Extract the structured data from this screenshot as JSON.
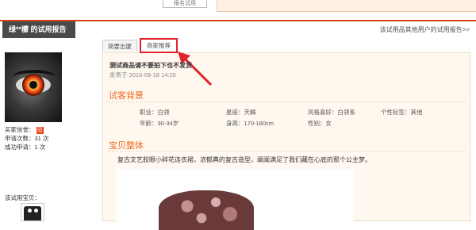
{
  "top": {
    "box_label": "报名试用"
  },
  "header": {
    "title": "绿**檬 的试用报告",
    "right_link": "该试用品其他用户的试用报告>>"
  },
  "left": {
    "stats": [
      {
        "label": "买家信誉：",
        "value": ""
      },
      {
        "label": "申请次数：",
        "value": "31 次"
      },
      {
        "label": "成功申请：",
        "value": "1 次"
      }
    ],
    "badge_icon": "heart-level-icon",
    "shop_label": "该试用宝贝："
  },
  "tabs": [
    {
      "label": "简要出厦"
    },
    {
      "label": "商家推荐"
    }
  ],
  "report": {
    "title": "测试商品请不要拍下也不发货",
    "date": "发表于 2016-09-18 14:26"
  },
  "background": {
    "heading": "试客背景",
    "row1": [
      {
        "label": "职业：",
        "value": "白领"
      },
      {
        "label": "星座：",
        "value": "天蝎"
      },
      {
        "label": "风格喜好：",
        "value": "白领系"
      },
      {
        "label": "个性标签：",
        "value": "其他"
      }
    ],
    "row2": [
      {
        "label": "年龄：",
        "value": "30-34岁"
      },
      {
        "label": "身高：",
        "value": "170-180cm"
      },
      {
        "label": "性别：",
        "value": "女"
      }
    ]
  },
  "product": {
    "heading": "宝贝整体",
    "description": "复古文艺胶眼小碎花连衣裙，浓郁典的复古造型，阐阐满足了我们藏在心底的那个公主梦。"
  },
  "colors": {
    "accent": "#cf4416",
    "highlight": "#e0242b",
    "section": "#ee6a1e"
  }
}
